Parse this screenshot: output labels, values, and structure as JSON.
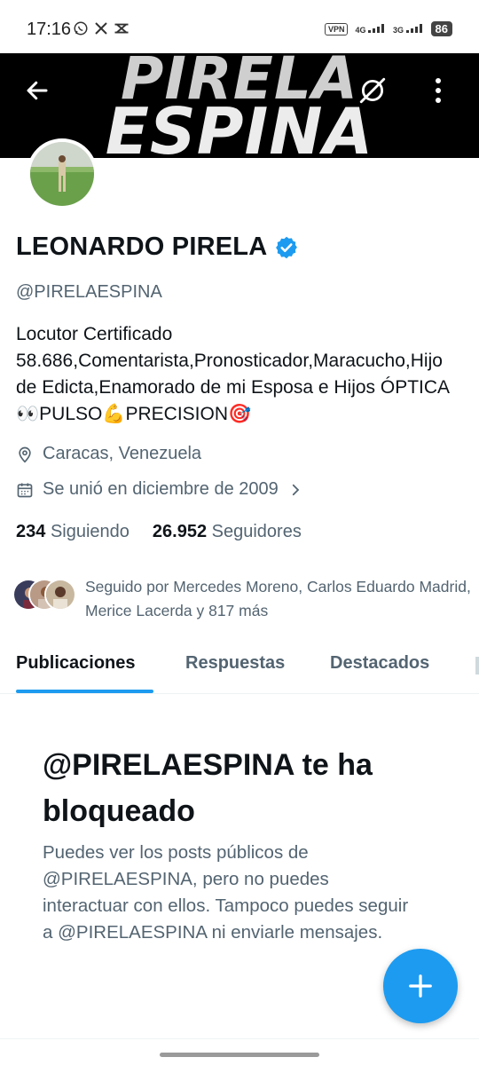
{
  "status_bar": {
    "time": "17:16",
    "vpn": "VPN",
    "net1": "4G",
    "net2": "3G",
    "battery": "86"
  },
  "banner": {
    "line1": "PIRELA",
    "line2": "ESPINA"
  },
  "profile": {
    "name": "LEONARDO PIRELA",
    "handle": "@PIRELAESPINA",
    "bio": "Locutor Certificado 58.686,Comentarista,Pronosticador,Maracucho,Hijo de Edicta,Enamorado de mi Esposa e Hijos  ÓPTICA👀PULSO💪PRECISION🎯",
    "location": "Caracas, Venezuela",
    "joined": "Se unió en diciembre de 2009",
    "following_count": "234",
    "following_label": "Siguiendo",
    "followers_count": "26.952",
    "followers_label": "Seguidores",
    "followed_by": "Seguido por Mercedes Moreno, Carlos Eduardo Madrid, Merice Lacerda y 817 más"
  },
  "tabs": [
    {
      "label": "Publicaciones"
    },
    {
      "label": "Respuestas"
    },
    {
      "label": "Destacados"
    }
  ],
  "blocked": {
    "title": "@PIRELAESPINA te ha bloqueado",
    "description": "Puedes ver los posts públicos de @PIRELAESPINA, pero no puedes interactuar con ellos. Tampoco puedes seguir a @PIRELAESPINA ni enviarle mensajes."
  },
  "colors": {
    "accent": "#1d9bf0",
    "text": "#0f1419",
    "secondary": "#536471"
  }
}
